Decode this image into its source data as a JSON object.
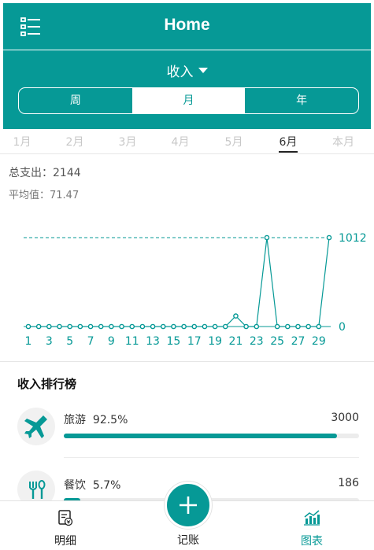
{
  "header": {
    "title": "Home",
    "menu_icon": "list-menu-icon"
  },
  "filter": {
    "dropdown_label": "收入",
    "segments": [
      "周",
      "月",
      "年"
    ],
    "active_segment": "月"
  },
  "months": {
    "items": [
      "1月",
      "2月",
      "3月",
      "4月",
      "5月",
      "6月",
      "本月"
    ],
    "active": "6月"
  },
  "summary": {
    "total": "总支出：2144",
    "average": "平均值：71.47"
  },
  "chart_data": {
    "type": "line",
    "x": [
      1,
      2,
      3,
      4,
      5,
      6,
      7,
      8,
      9,
      10,
      11,
      12,
      13,
      14,
      15,
      16,
      17,
      18,
      19,
      20,
      21,
      22,
      23,
      24,
      25,
      26,
      27,
      28,
      29,
      30
    ],
    "values": [
      0,
      0,
      0,
      0,
      0,
      0,
      0,
      0,
      0,
      0,
      0,
      0,
      0,
      0,
      0,
      0,
      0,
      0,
      0,
      0,
      120,
      0,
      0,
      1012,
      0,
      0,
      0,
      0,
      0,
      1012
    ],
    "x_tick_labels": [
      "1",
      "3",
      "5",
      "7",
      "9",
      "11",
      "13",
      "15",
      "17",
      "19",
      "21",
      "23",
      "25",
      "27",
      "29"
    ],
    "reference_lines": [
      {
        "value": 1012,
        "label": "1012",
        "style": "dashed"
      },
      {
        "value": 0,
        "label": "0",
        "style": "solid"
      }
    ],
    "ylim": [
      0,
      1012
    ],
    "color": "#069996"
  },
  "ranking": {
    "title": "收入排行榜",
    "items": [
      {
        "name": "旅游",
        "percent": "92.5%",
        "amount": "3000",
        "fraction": 0.925,
        "icon": "airplane-icon"
      },
      {
        "name": "餐饮",
        "percent": "5.7%",
        "amount": "186",
        "fraction": 0.057,
        "icon": "fork-spoon-icon"
      }
    ]
  },
  "bottom_nav": {
    "items": [
      {
        "label": "明细",
        "icon": "receipt-icon"
      },
      {
        "label": "记账",
        "icon": "plus-icon"
      },
      {
        "label": "图表",
        "icon": "bar-chart-icon"
      }
    ],
    "active": "图表"
  },
  "colors": {
    "accent": "#069996",
    "text": "#333333",
    "muted": "#c8c8c8"
  }
}
